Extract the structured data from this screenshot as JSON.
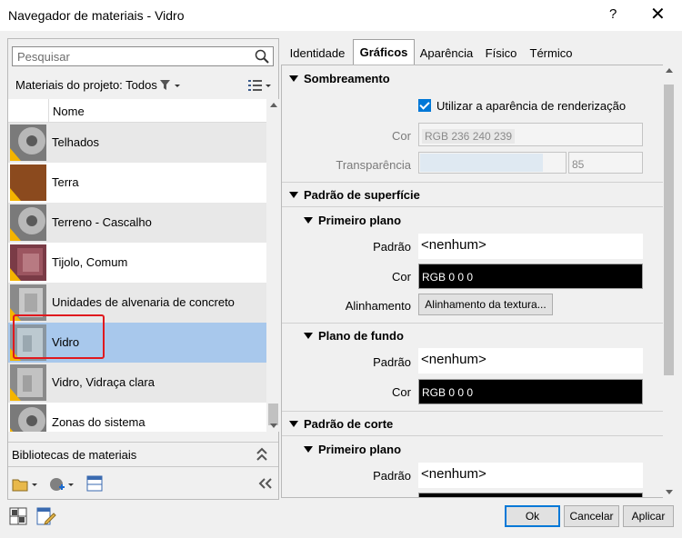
{
  "window": {
    "title": "Navegador de materiais - Vidro",
    "help": "?",
    "close": "✕"
  },
  "search": {
    "placeholder": "Pesquisar"
  },
  "project_filter": "Materiais do projeto: Todos",
  "list": {
    "column": "Nome",
    "items": [
      {
        "label": "Telhados",
        "thumb": "sphere"
      },
      {
        "label": "Terra",
        "thumb": "earth"
      },
      {
        "label": "Terreno - Cascalho",
        "thumb": "sphere"
      },
      {
        "label": "Tijolo, Comum",
        "thumb": "brick"
      },
      {
        "label": "Unidades de alvenaria de concreto",
        "thumb": "block"
      },
      {
        "label": "Vidro",
        "thumb": "glass",
        "selected": true
      },
      {
        "label": "Vidro, Vidraça clara",
        "thumb": "glass"
      },
      {
        "label": "Zonas do sistema",
        "thumb": "sphere"
      }
    ]
  },
  "libraries": {
    "label": "Bibliotecas de materiais"
  },
  "tabs": [
    {
      "label": "Identidade"
    },
    {
      "label": "Gráficos",
      "active": true
    },
    {
      "label": "Aparência"
    },
    {
      "label": "Físico"
    },
    {
      "label": "Térmico"
    }
  ],
  "shading": {
    "header": "Sombreamento",
    "use_render_label": "Utilizar a aparência de renderização",
    "color_label": "Cor",
    "color_value": "RGB 236 240 239",
    "transparency_label": "Transparência",
    "transparency_value": "85",
    "transparency_level": 0.85
  },
  "surface": {
    "header": "Padrão de superfície",
    "foreground": {
      "header": "Primeiro plano",
      "pattern_label": "Padrão",
      "pattern_value": "<nenhum>",
      "color_label": "Cor",
      "color_value": "RGB 0 0 0",
      "align_label": "Alinhamento",
      "align_button": "Alinhamento da textura..."
    },
    "background": {
      "header": "Plano de fundo",
      "pattern_label": "Padrão",
      "pattern_value": "<nenhum>",
      "color_label": "Cor",
      "color_value": "RGB 0 0 0"
    }
  },
  "cut": {
    "header": "Padrão de corte",
    "foreground": {
      "header": "Primeiro plano",
      "pattern_label": "Padrão",
      "pattern_value": "<nenhum>"
    }
  },
  "footer": {
    "ok": "Ok",
    "cancel": "Cancelar",
    "apply": "Aplicar"
  }
}
